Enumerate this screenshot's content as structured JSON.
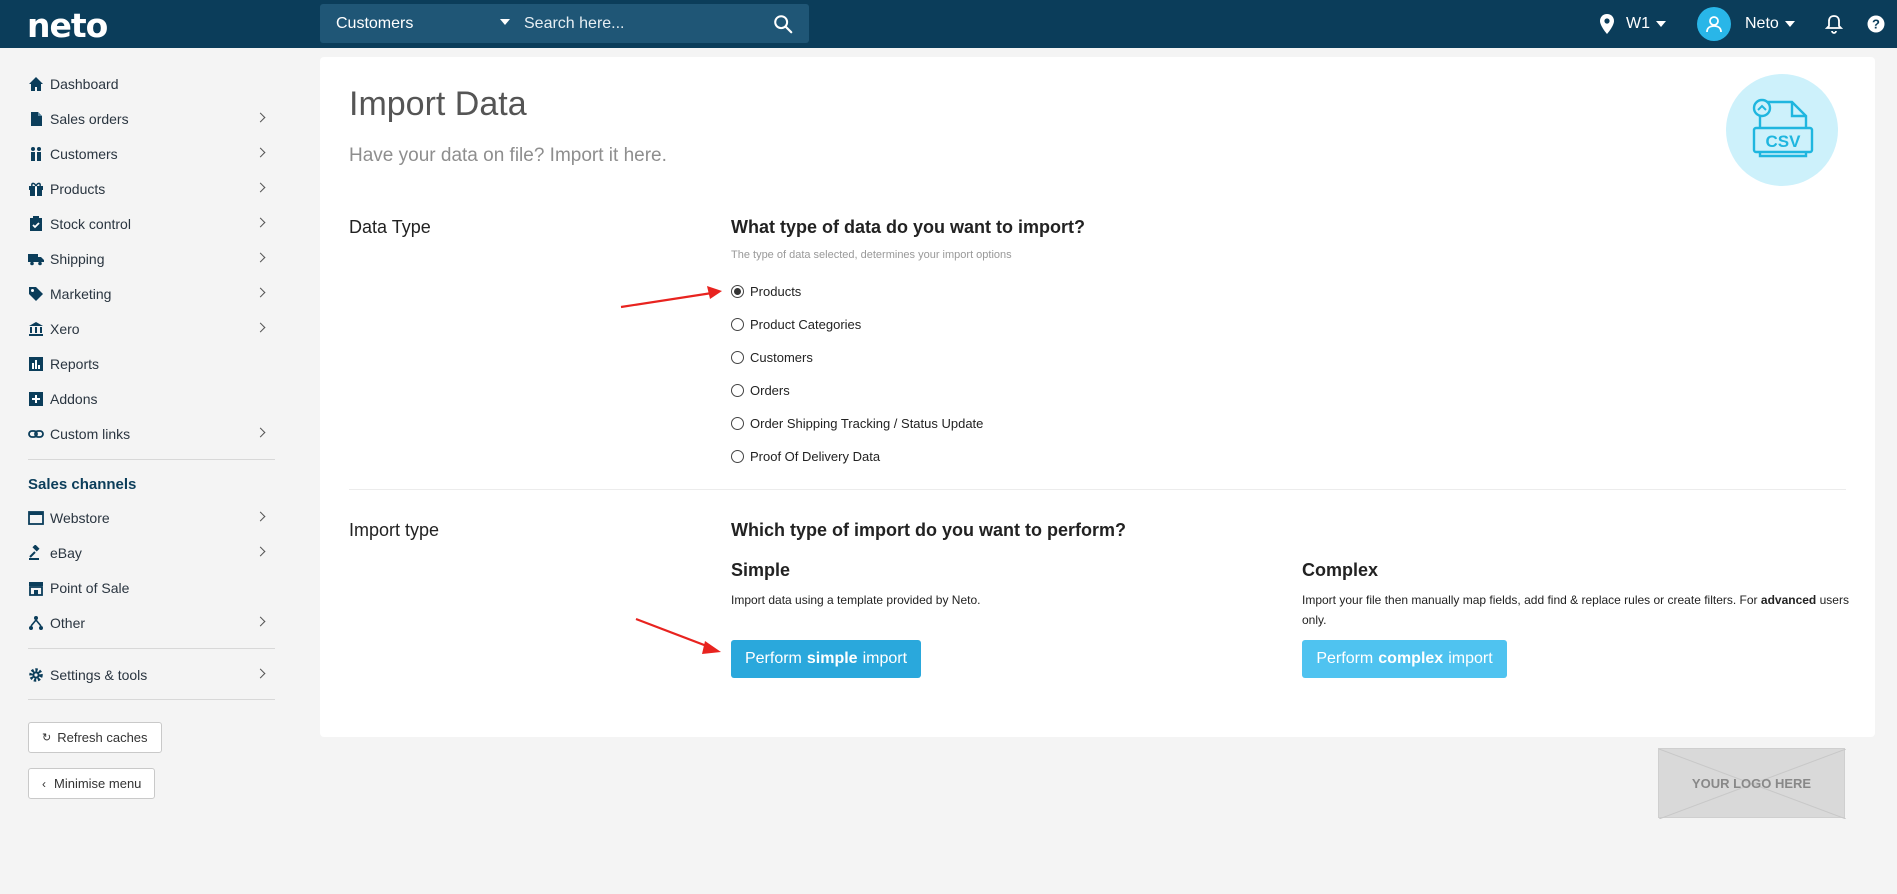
{
  "topbar": {
    "logo": "neto",
    "scope_label": "Customers",
    "search_placeholder": "Search here...",
    "location": "W1",
    "user": "Neto"
  },
  "sidebar": {
    "items": [
      {
        "label": "Dashboard",
        "icon": "home-icon",
        "chevron": false
      },
      {
        "label": "Sales orders",
        "icon": "document-icon",
        "chevron": true
      },
      {
        "label": "Customers",
        "icon": "users-icon",
        "chevron": true
      },
      {
        "label": "Products",
        "icon": "gift-icon",
        "chevron": true
      },
      {
        "label": "Stock control",
        "icon": "clipboard-check-icon",
        "chevron": true
      },
      {
        "label": "Shipping",
        "icon": "truck-icon",
        "chevron": true
      },
      {
        "label": "Marketing",
        "icon": "tag-icon",
        "chevron": true
      },
      {
        "label": "Xero",
        "icon": "bank-icon",
        "chevron": true
      },
      {
        "label": "Reports",
        "icon": "bar-chart-icon",
        "chevron": false
      },
      {
        "label": "Addons",
        "icon": "plus-square-icon",
        "chevron": false
      },
      {
        "label": "Custom links",
        "icon": "link-icon",
        "chevron": true
      }
    ],
    "sales_channels_title": "Sales channels",
    "channels": [
      {
        "label": "Webstore",
        "icon": "browser-icon",
        "chevron": true
      },
      {
        "label": "eBay",
        "icon": "gavel-icon",
        "chevron": true
      },
      {
        "label": "Point of Sale",
        "icon": "store-icon",
        "chevron": false
      },
      {
        "label": "Other",
        "icon": "sitemap-icon",
        "chevron": true
      }
    ],
    "settings": {
      "label": "Settings & tools",
      "icon": "gear-icon",
      "chevron": true
    },
    "refresh_label": "Refresh caches",
    "minimise_label": "Minimise menu"
  },
  "main": {
    "title": "Import Data",
    "subtitle": "Have your data on file? Import it here.",
    "csv_badge": "CSV",
    "data_type": {
      "label": "Data Type",
      "question": "What type of data do you want to import?",
      "hint": "The type of data selected, determines your import options",
      "options": [
        {
          "label": "Products",
          "checked": true
        },
        {
          "label": "Product Categories",
          "checked": false
        },
        {
          "label": "Customers",
          "checked": false
        },
        {
          "label": "Orders",
          "checked": false
        },
        {
          "label": "Order Shipping Tracking / Status Update",
          "checked": false
        },
        {
          "label": "Proof Of Delivery Data",
          "checked": false
        }
      ]
    },
    "import_type": {
      "label": "Import type",
      "question": "Which type of import do you want to perform?",
      "simple": {
        "title": "Simple",
        "desc": "Import data using a template provided by Neto.",
        "btn_pre": "Perform",
        "btn_bold": "simple",
        "btn_post": "import",
        "color": "#2aa8dc"
      },
      "complex": {
        "title": "Complex",
        "desc_pre": "Import your file then manually map fields, add find & replace rules or create filters. For",
        "desc_bold": "advanced",
        "desc_post": "users only.",
        "btn_pre": "Perform",
        "btn_bold": "complex",
        "btn_post": "import",
        "color": "#4fc3f0"
      }
    }
  },
  "logo_placeholder": "YOUR LOGO HERE"
}
